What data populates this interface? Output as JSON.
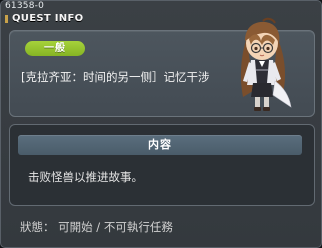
{
  "window": {
    "quest_id": "61358-0",
    "title": "QUEST INFO"
  },
  "quest": {
    "category": "一般",
    "name": "[克拉齐亚：时间的另一侧］记忆干涉",
    "npc_icon": "npc-character-portrait"
  },
  "content_section": {
    "header": "内容",
    "description": "击败怪兽以推进故事。"
  },
  "status": {
    "text": "狀態： 可開始 / 不可執行任務"
  },
  "colors": {
    "badge": "#95c22f",
    "header": "#52667a",
    "background": "#373c41"
  }
}
